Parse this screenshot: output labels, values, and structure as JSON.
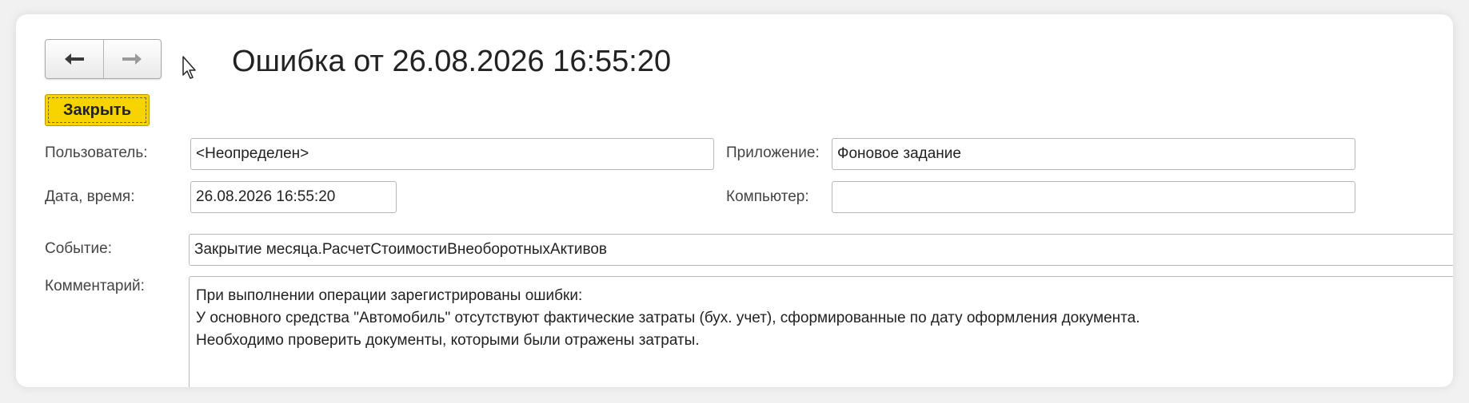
{
  "window": {
    "title": "Ошибка от 26.08.2026 16:55:20"
  },
  "nav": {
    "back_icon": "arrow-left-icon",
    "forward_icon": "arrow-right-icon"
  },
  "toolbar": {
    "close_label": "Закрыть",
    "close_color": "#f7d400"
  },
  "form": {
    "user_label": "Пользователь:",
    "user_value": "<Неопределен>",
    "app_label": "Приложение:",
    "app_value": "Фоновое задание",
    "datetime_label": "Дата, время:",
    "datetime_value": "26.08.2026 16:55:20",
    "computer_label": "Компьютер:",
    "computer_value": "",
    "event_label": "Событие:",
    "event_value": "Закрытие месяца.РасчетСтоимостиВнеоборотныхАктивов",
    "comment_label": "Комментарий:",
    "comment_lines": [
      "При выполнении операции зарегистрированы ошибки:",
      "У основного средства \"Автомобиль\" отсутствуют фактические затраты (бух. учет), сформированные по дату оформления документа.",
      "Необходимо проверить документы, которыми были отражены затраты."
    ]
  }
}
